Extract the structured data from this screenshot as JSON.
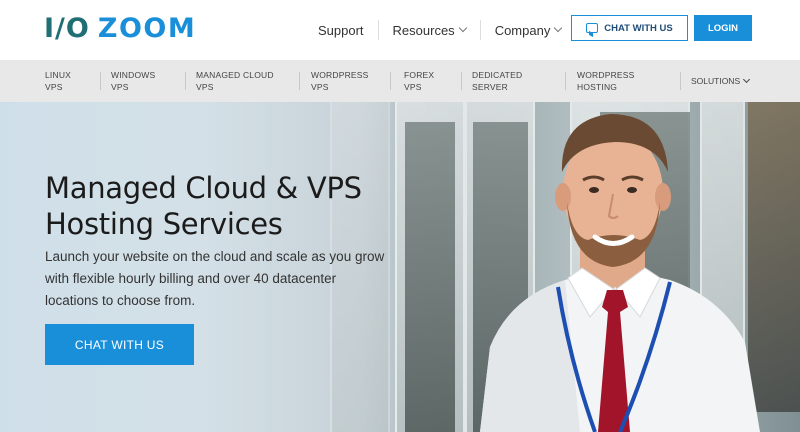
{
  "brand": {
    "part1": "I/O",
    "part2": "ZOOM"
  },
  "topnav": [
    {
      "label": "Support",
      "has_dropdown": false
    },
    {
      "label": "Resources",
      "has_dropdown": true
    },
    {
      "label": "Company",
      "has_dropdown": true
    }
  ],
  "header_actions": {
    "chat_label": "CHAT WITH US",
    "login_label": "LOGIN"
  },
  "subnav": [
    {
      "line1": "LINUX",
      "line2": "VPS"
    },
    {
      "line1": "WINDOWS",
      "line2": "VPS"
    },
    {
      "line1": "MANAGED CLOUD",
      "line2": "VPS"
    },
    {
      "line1": "WORDPRESS",
      "line2": "VPS"
    },
    {
      "line1": "FOREX",
      "line2": "VPS"
    },
    {
      "line1": "DEDICATED",
      "line2": "SERVER"
    },
    {
      "line1": "WORDPRESS",
      "line2": "HOSTING"
    }
  ],
  "subnav_more": "SOLUTIONS",
  "hero": {
    "title_line1": "Managed Cloud & VPS",
    "title_line2": "Hosting Services",
    "subtitle": "Launch your website on the cloud and scale as you grow with flexible hourly billing and over 40 datacenter locations to choose from.",
    "cta_label": "CHAT WITH US"
  },
  "colors": {
    "accent": "#1a8fd9",
    "logo_dark": "#1f6f74",
    "subnav_bg": "#e8e8e8"
  }
}
